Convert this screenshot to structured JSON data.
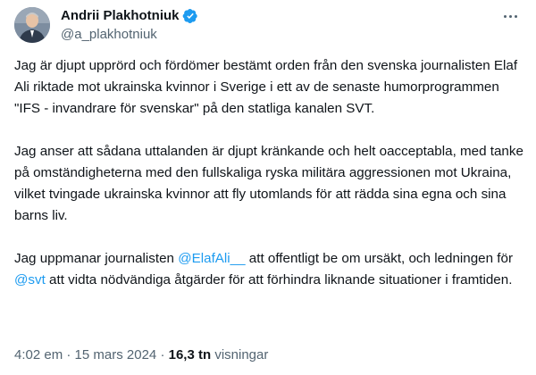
{
  "author": {
    "name": "Andrii Plakhotniuk",
    "handle": "@a_plakhotniuk",
    "verified_color": "#1d9bf0"
  },
  "tweet": {
    "p1": "Jag är djupt upprörd och fördömer bestämt orden från den svenska journalisten Elaf Ali riktade mot ukrainska kvinnor i Sverige i ett av de senaste humorprogrammen \"IFS - invandrare för svenskar\" på den statliga kanalen SVT.",
    "p2": "Jag anser att sådana uttalanden är djupt kränkande och helt oacceptabla, med tanke på omständigheterna med den fullskaliga ryska militära aggressionen mot Ukraina, vilket tvingade ukrainska kvinnor att fly utomlands för att rädda sina egna och sina barns liv.",
    "p3_a": "Jag uppmanar journalisten ",
    "mention1": "@ElafAli__",
    "p3_b": " att offentligt be om ursäkt, och ledningen för ",
    "mention2": "@svt",
    "p3_c": " att vidta nödvändiga åtgärder för att förhindra liknande situationer i framtiden."
  },
  "meta": {
    "time": "4:02 em",
    "separator": " · ",
    "date": "15 mars 2024",
    "separator2": " · ",
    "views_count": "16,3 tn",
    "views_label": " visningar"
  },
  "colors": {
    "link": "#1d9bf0",
    "secondary_text": "#536471",
    "primary_text": "#0f1419"
  },
  "icons": {
    "verified": "verified-badge-icon",
    "more": "more-options-icon"
  }
}
